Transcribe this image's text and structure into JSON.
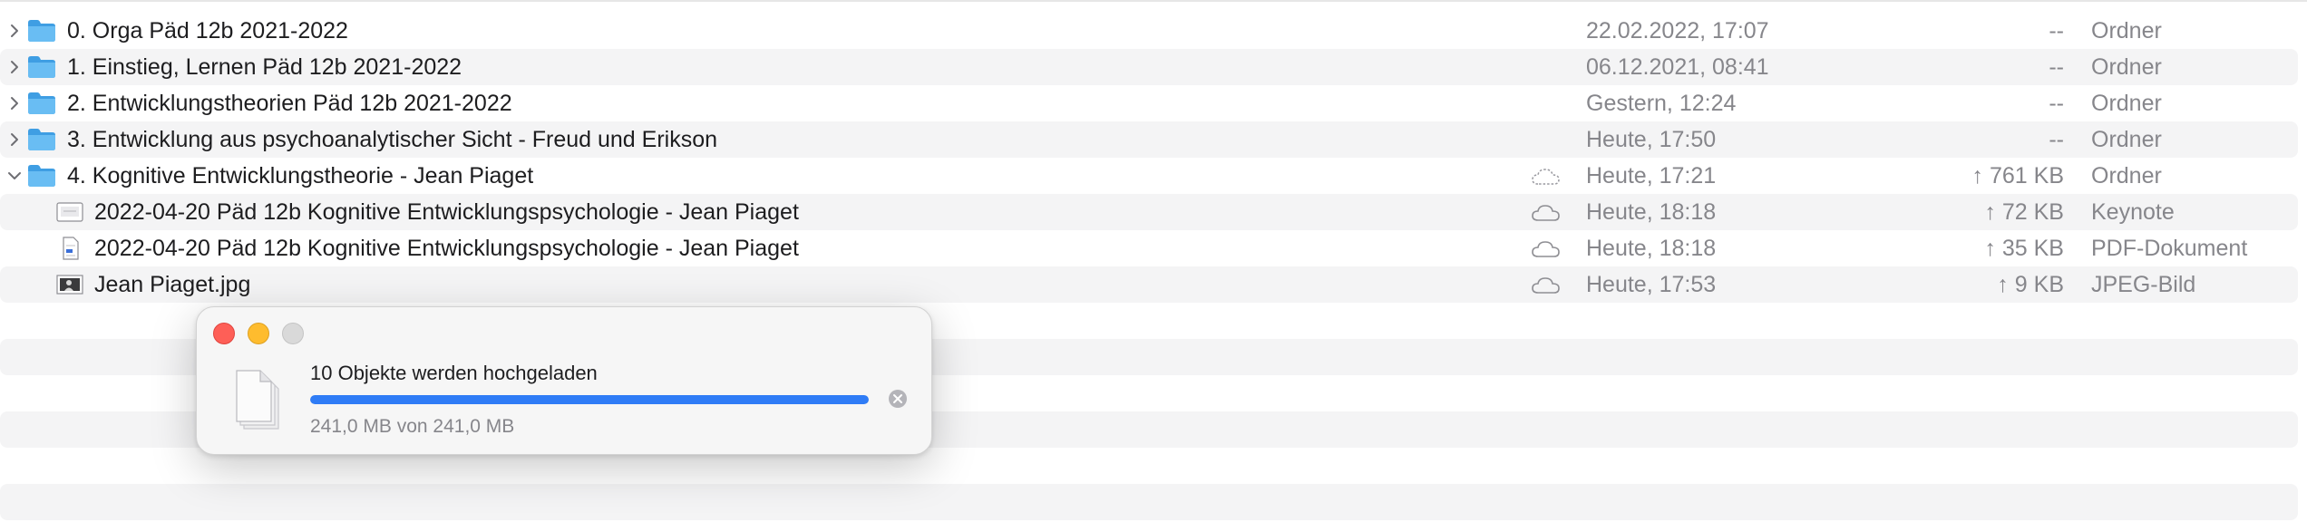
{
  "files": [
    {
      "name": "0. Orga Päd 12b 2021-2022",
      "date": "22.02.2022, 17:07",
      "size": "--",
      "kind": "Ordner"
    },
    {
      "name": "1. Einstieg, Lernen Päd 12b 2021-2022",
      "date": "06.12.2021, 08:41",
      "size": "--",
      "kind": "Ordner"
    },
    {
      "name": "2. Entwicklungstheorien Päd 12b 2021-2022",
      "date": "Gestern, 12:24",
      "size": "--",
      "kind": "Ordner"
    },
    {
      "name": "3. Entwicklung aus psychoanalytischer Sicht - Freud und Erikson",
      "date": "Heute, 17:50",
      "size": "--",
      "kind": "Ordner"
    },
    {
      "name": "4. Kognitive Entwicklungstheorie - Jean Piaget",
      "date": "Heute, 17:21",
      "size": "↑ 761 KB",
      "kind": "Ordner"
    },
    {
      "name": "2022-04-20 Päd 12b Kognitive Entwicklungspsychologie - Jean Piaget",
      "date": "Heute, 18:18",
      "size": "↑ 72 KB",
      "kind": "Keynote"
    },
    {
      "name": "2022-04-20 Päd 12b Kognitive Entwicklungspsychologie - Jean Piaget",
      "date": "Heute, 18:18",
      "size": "↑ 35 KB",
      "kind": "PDF-Dokument"
    },
    {
      "name": "Jean Piaget.jpg",
      "date": "Heute, 17:53",
      "size": "↑ 9 KB",
      "kind": "JPEG-Bild"
    }
  ],
  "upload_dialog": {
    "title": "10 Objekte werden hochgeladen",
    "progress": "241,0 MB von 241,0 MB",
    "progress_fraction": 1.0
  },
  "colors": {
    "folder": "#5fb7f0",
    "accent": "#2f7cf6",
    "close": "#fe5f57",
    "minimize": "#febc2e"
  },
  "icons": {
    "collapsed": "chevron-right-icon",
    "expanded": "chevron-down-icon",
    "folder": "folder-icon",
    "cloud": "cloud-icon",
    "cancel": "cancel-icon"
  }
}
